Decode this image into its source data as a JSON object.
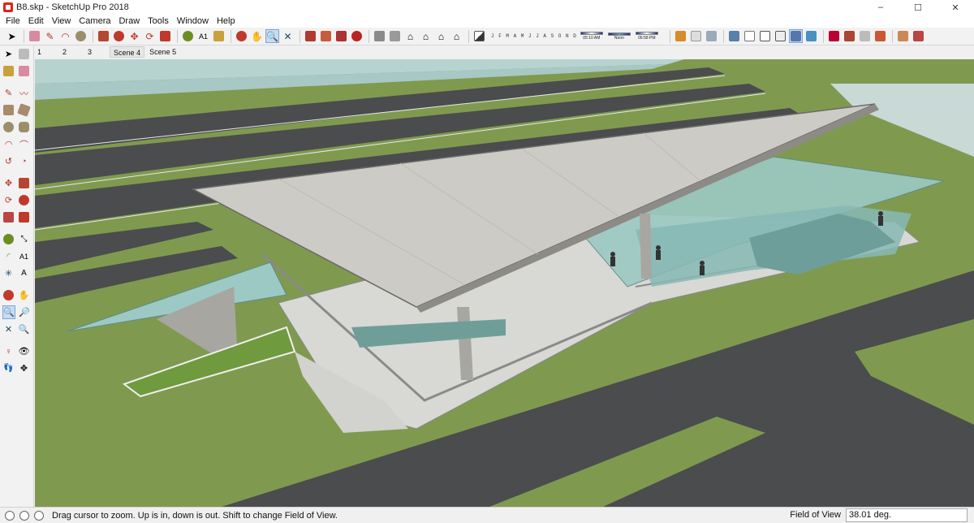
{
  "window": {
    "title": "B8.skp - SketchUp Pro 2018",
    "controls": {
      "minimize": "–",
      "maximize": "☐",
      "close": "✕"
    }
  },
  "menu": [
    "File",
    "Edit",
    "View",
    "Camera",
    "Draw",
    "Tools",
    "Window",
    "Help"
  ],
  "toolbar": {
    "shadow_months": "J F M A M J J A S O N D",
    "time_label": "05:10 AM",
    "noon_label": "Noon",
    "sun_time": "06:58 PM",
    "active_tool": "zoom"
  },
  "scenes": [
    "1",
    "2",
    "3",
    "Scene 4",
    "Scene 5"
  ],
  "active_scene": "Scene 4",
  "status": {
    "message": "Drag cursor to zoom.  Up is in, down is out. Shift to change Field of View.",
    "vcb_label": "Field of View",
    "vcb_value": "38.01 deg."
  },
  "colors": {
    "ground_green": "#7f9a4f",
    "road": "#4a4c4e",
    "roof": "#cdcbc5",
    "glass": "#9cc9c4",
    "sky": "#c9d9d5"
  }
}
